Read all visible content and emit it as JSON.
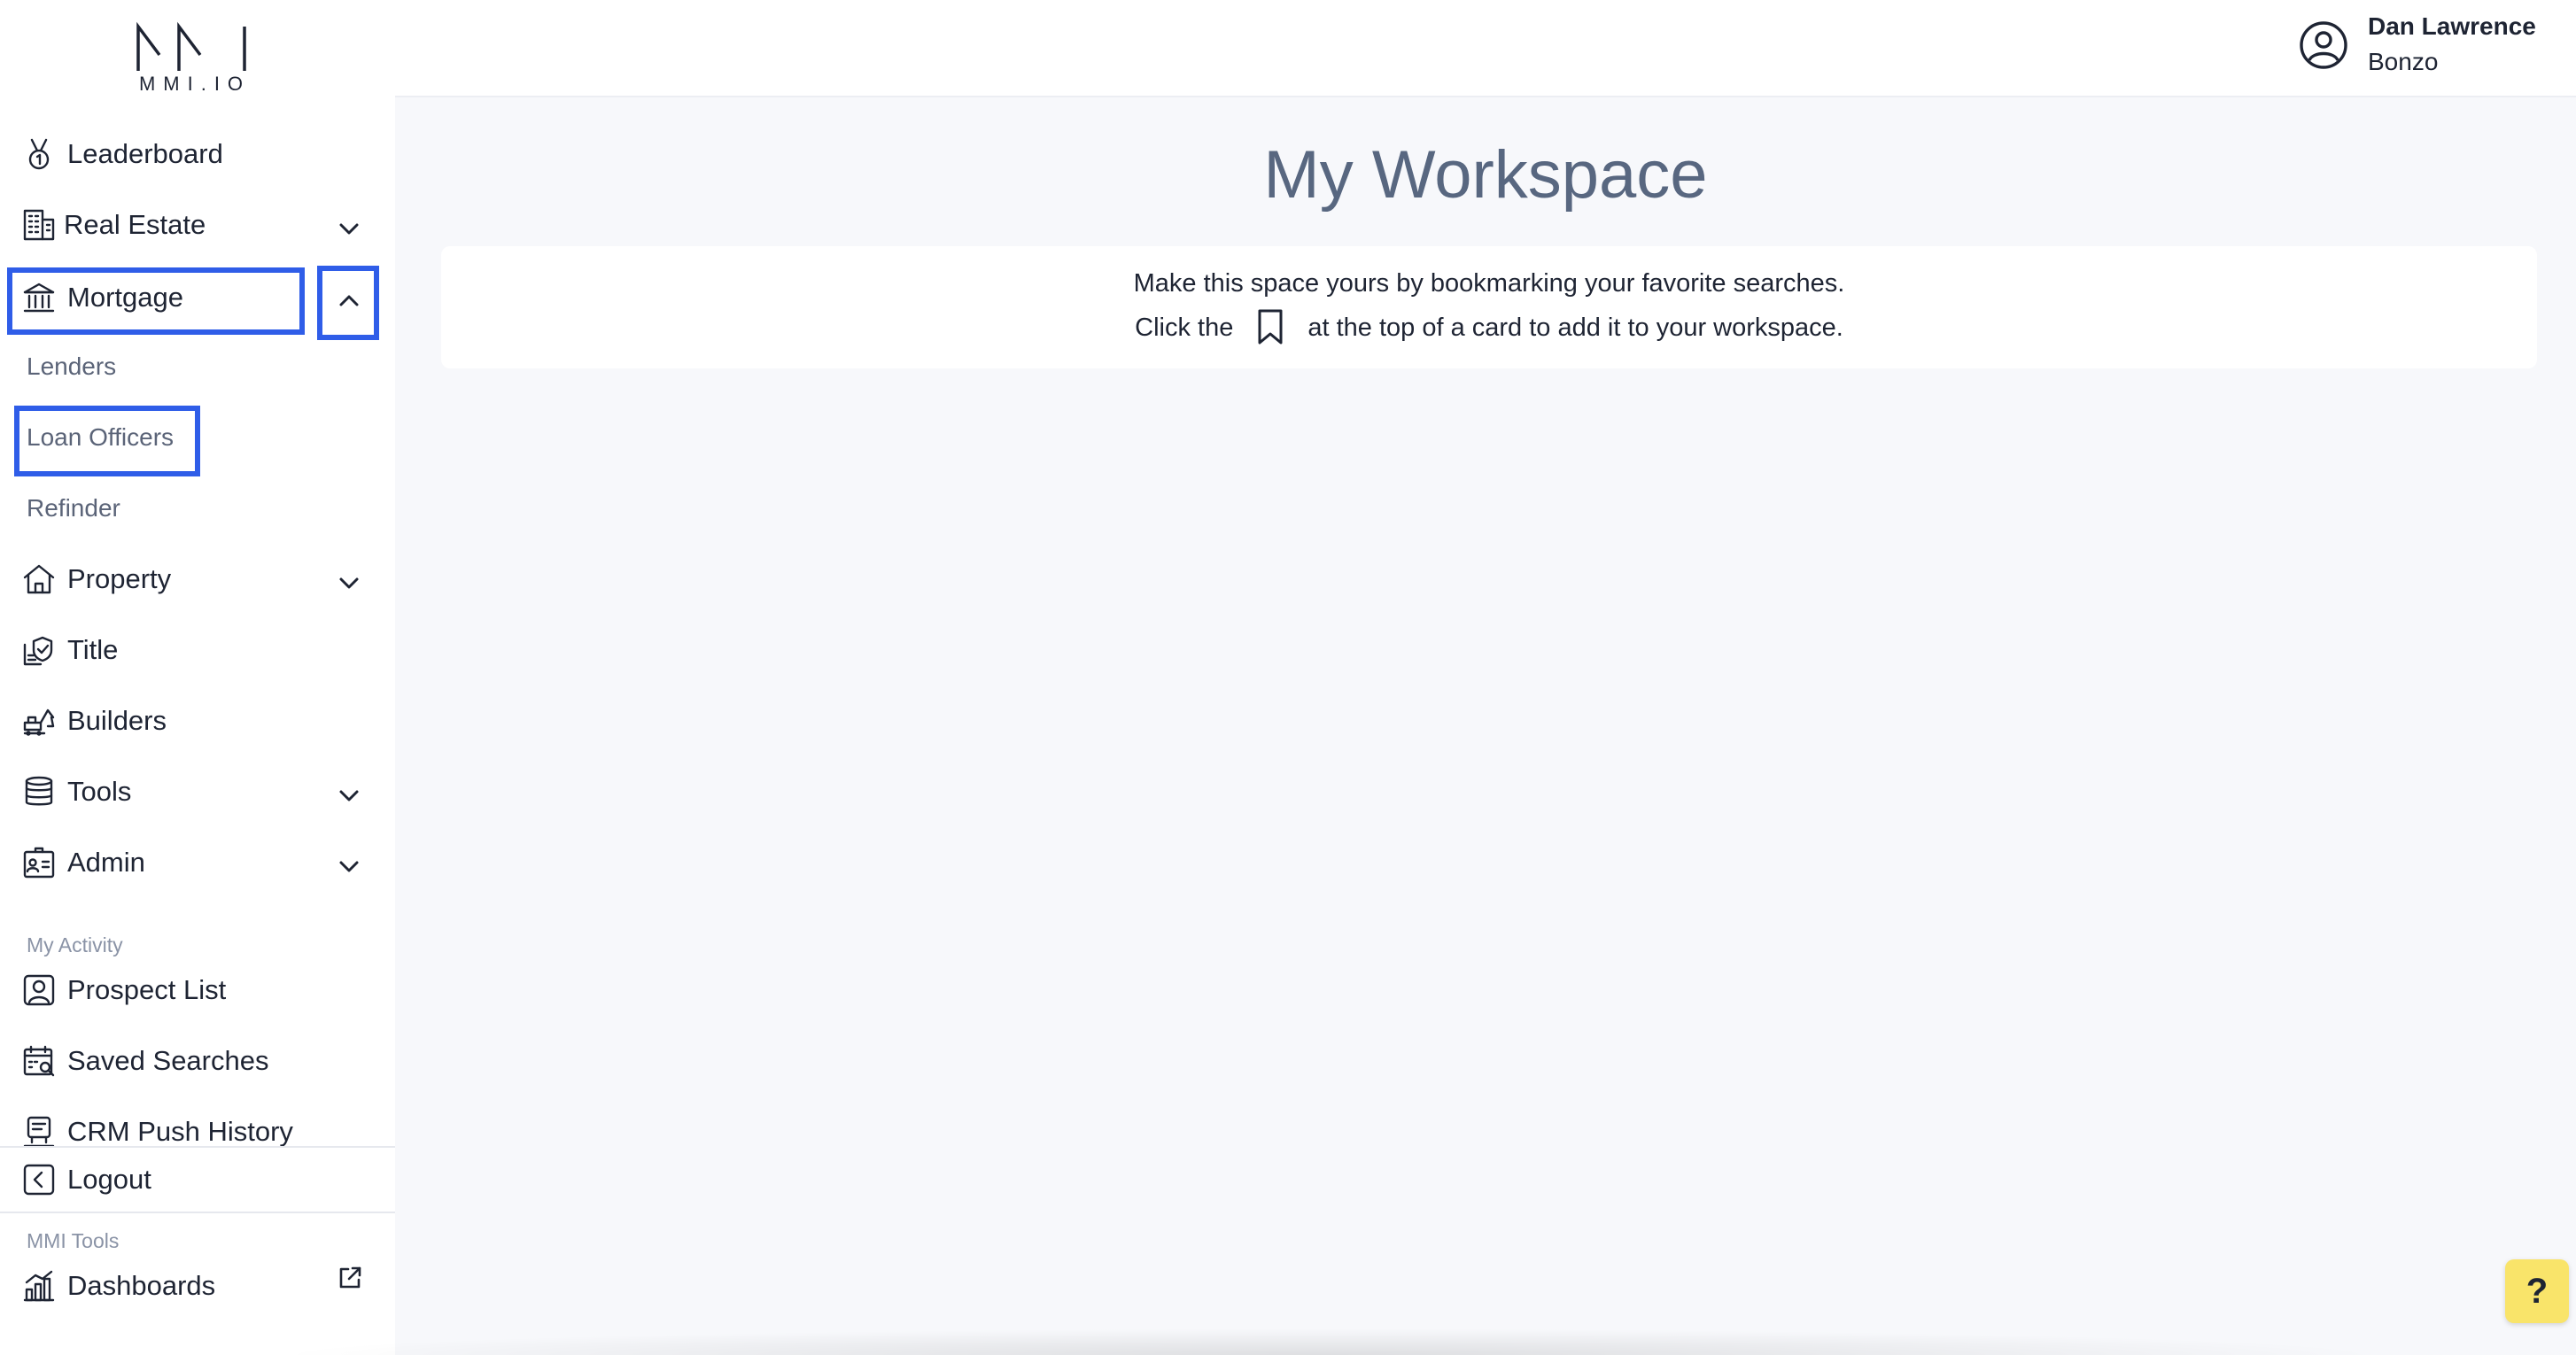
{
  "brand": {
    "logo_text": "MMI.IO"
  },
  "user": {
    "name": "Dan Lawrence",
    "org": "Bonzo",
    "icon": "user-circle-icon"
  },
  "sidebar": {
    "items": [
      {
        "label": "Leaderboard",
        "icon": "medal-icon"
      },
      {
        "label": "Real Estate",
        "icon": "building-icon"
      },
      {
        "label": "Mortgage",
        "icon": "bank-icon"
      },
      {
        "label": "Property",
        "icon": "house-icon"
      },
      {
        "label": "Title",
        "icon": "title-shield-icon"
      },
      {
        "label": "Builders",
        "icon": "excavator-icon"
      },
      {
        "label": "Tools",
        "icon": "database-icon"
      },
      {
        "label": "Admin",
        "icon": "id-card-icon"
      }
    ],
    "mortgage_sub": [
      "Lenders",
      "Loan Officers",
      "Refinder"
    ],
    "my_activity_label": "My Activity",
    "activity": [
      {
        "label": "Prospect List",
        "icon": "prospect-icon"
      },
      {
        "label": "Saved Searches",
        "icon": "calendar-search-icon"
      },
      {
        "label": "CRM Push History",
        "icon": "crm-icon"
      }
    ],
    "logout_label": "Logout",
    "mmi_tools_label": "MMI Tools",
    "dashboards_label": "Dashboards"
  },
  "main": {
    "title": "My Workspace",
    "line1": "Make this space yours by bookmarking your favorite searches.",
    "line2_before": "Click the",
    "line2_after": "at the top of a card to add it to your workspace."
  },
  "help": {
    "label": "?"
  },
  "colors": {
    "highlight": "#2f5de8",
    "help_bg": "#f9e46a",
    "title": "#586780"
  }
}
